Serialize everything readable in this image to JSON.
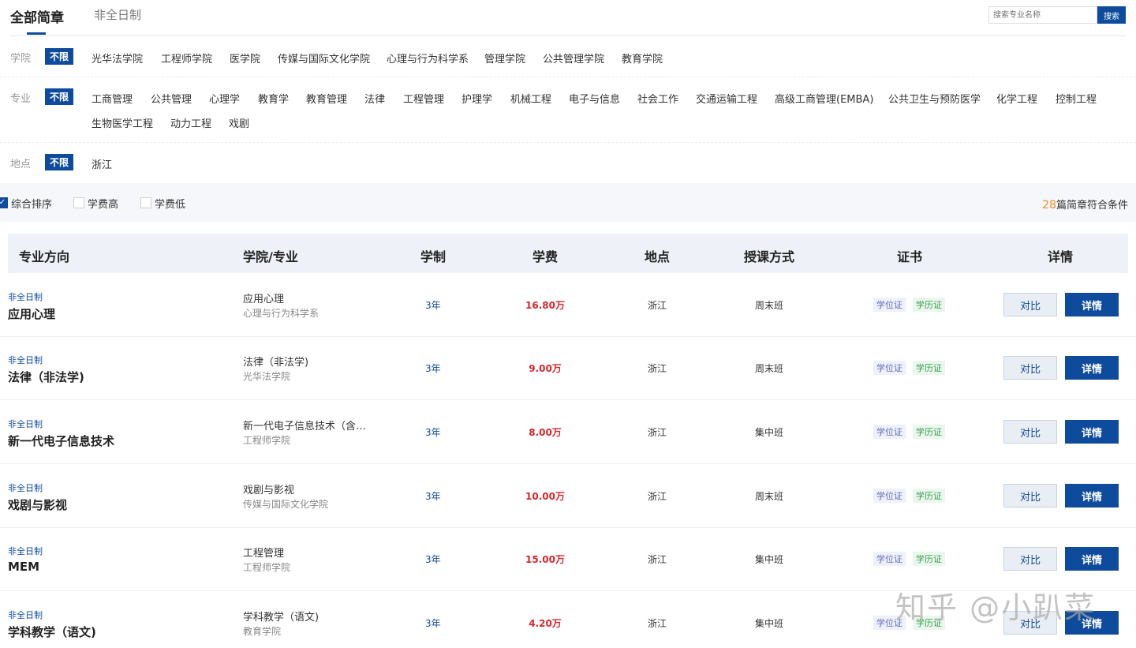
{
  "tabs": {
    "active": "全部简章",
    "inactive": "非全日制"
  },
  "search": {
    "placeholder": "搜索专业名称",
    "button": "搜索"
  },
  "filters": {
    "college": {
      "label": "学院",
      "all": "不限",
      "options": [
        "光华法学院",
        "工程师学院",
        "医学院",
        "传媒与国际文化学院",
        "心理与行为科学系",
        "管理学院",
        "公共管理学院",
        "教育学院"
      ]
    },
    "major": {
      "label": "专业",
      "all": "不限",
      "options": [
        "工商管理",
        "公共管理",
        "心理学",
        "教育学",
        "教育管理",
        "法律",
        "工程管理",
        "护理学",
        "机械工程",
        "电子与信息",
        "社会工作",
        "交通运输工程",
        "高级工商管理(EMBA)",
        "公共卫生与预防医学",
        "化学工程",
        "控制工程",
        "生物医学工程",
        "动力工程",
        "戏剧"
      ]
    },
    "location": {
      "label": "地点",
      "all": "不限",
      "options": [
        "浙江"
      ]
    }
  },
  "sort": {
    "options": [
      {
        "label": "综合排序",
        "checked": true
      },
      {
        "label": "学费高",
        "checked": false
      },
      {
        "label": "学费低",
        "checked": false
      }
    ],
    "count": "28",
    "count_suffix": "篇简章符合条件"
  },
  "table": {
    "headers": [
      "专业方向",
      "学院/专业",
      "学制",
      "学费",
      "地点",
      "授课方式",
      "证书",
      "详情"
    ],
    "rows": [
      {
        "type": "非全日制",
        "direction": "应用心理",
        "major": "应用心理",
        "school": "心理与行为科学系",
        "duration": "3年",
        "fee": "16.80万",
        "place": "浙江",
        "mode": "周末班",
        "cert1": "学位证",
        "cert2": "学历证",
        "compare": "对比",
        "detail": "详情"
      },
      {
        "type": "非全日制",
        "direction": "法律（非法学)",
        "major": "法律（非法学)",
        "school": "光华法学院",
        "duration": "3年",
        "fee": "9.00万",
        "place": "浙江",
        "mode": "周末班",
        "cert1": "学位证",
        "cert2": "学历证",
        "compare": "对比",
        "detail": "详情"
      },
      {
        "type": "非全日制",
        "direction": "新一代电子信息技术",
        "major": "新一代电子信息技术（含…",
        "school": "工程师学院",
        "duration": "3年",
        "fee": "8.00万",
        "place": "浙江",
        "mode": "集中班",
        "cert1": "学位证",
        "cert2": "学历证",
        "compare": "对比",
        "detail": "详情"
      },
      {
        "type": "非全日制",
        "direction": "戏剧与影视",
        "major": "戏剧与影视",
        "school": "传媒与国际文化学院",
        "duration": "3年",
        "fee": "10.00万",
        "place": "浙江",
        "mode": "周末班",
        "cert1": "学位证",
        "cert2": "学历证",
        "compare": "对比",
        "detail": "详情"
      },
      {
        "type": "非全日制",
        "direction": "MEM",
        "major": "工程管理",
        "school": "工程师学院",
        "duration": "3年",
        "fee": "15.00万",
        "place": "浙江",
        "mode": "集中班",
        "cert1": "学位证",
        "cert2": "学历证",
        "compare": "对比",
        "detail": "详情"
      },
      {
        "type": "非全日制",
        "direction": "学科教学（语文)",
        "major": "学科教学（语文)",
        "school": "教育学院",
        "duration": "3年",
        "fee": "4.20万",
        "place": "浙江",
        "mode": "集中班",
        "cert1": "学位证",
        "cert2": "学历证",
        "compare": "对比",
        "detail": "详情"
      }
    ]
  },
  "watermark": "知乎 @小趴菜"
}
